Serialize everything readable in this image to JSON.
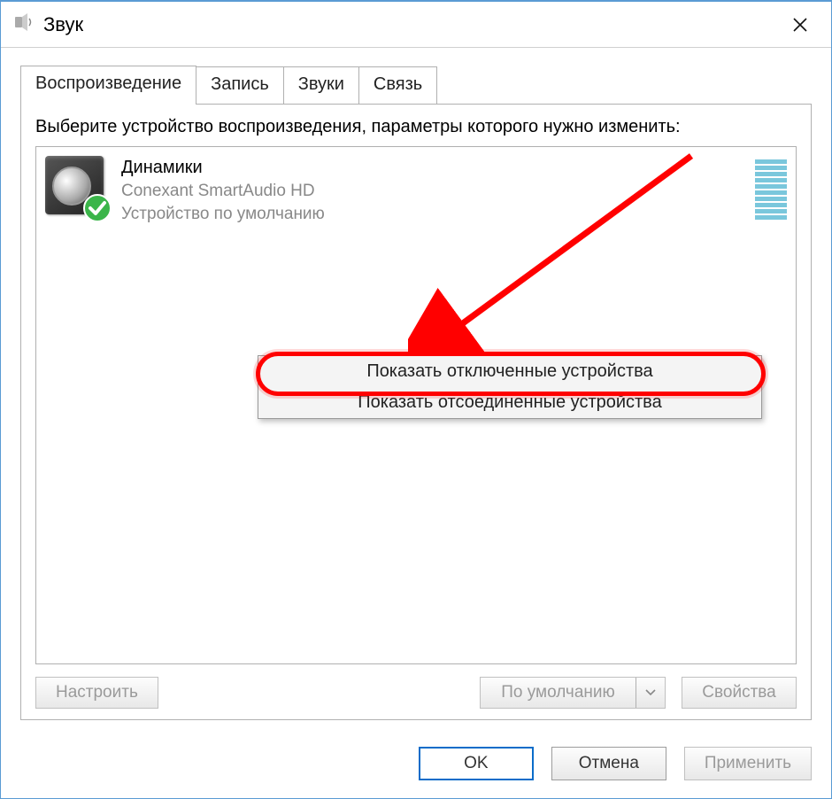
{
  "window": {
    "title": "Звук"
  },
  "tabs": {
    "items": [
      {
        "label": "Воспроизведение",
        "active": true
      },
      {
        "label": "Запись",
        "active": false
      },
      {
        "label": "Звуки",
        "active": false
      },
      {
        "label": "Связь",
        "active": false
      }
    ]
  },
  "instruction": "Выберите устройство воспроизведения, параметры которого нужно изменить:",
  "device": {
    "name": "Динамики",
    "driver": "Conexant SmartAudio HD",
    "status": "Устройство по умолчанию",
    "default": true
  },
  "context_menu": {
    "items": [
      {
        "label": "Показать отключенные устройства",
        "highlighted": true
      },
      {
        "label": "Показать отсоединенные устройства",
        "highlighted": false
      }
    ]
  },
  "panel_buttons": {
    "configure": "Настроить",
    "set_default": "По умолчанию",
    "properties": "Свойства"
  },
  "dialog_buttons": {
    "ok": "OK",
    "cancel": "Отмена",
    "apply": "Применить"
  }
}
